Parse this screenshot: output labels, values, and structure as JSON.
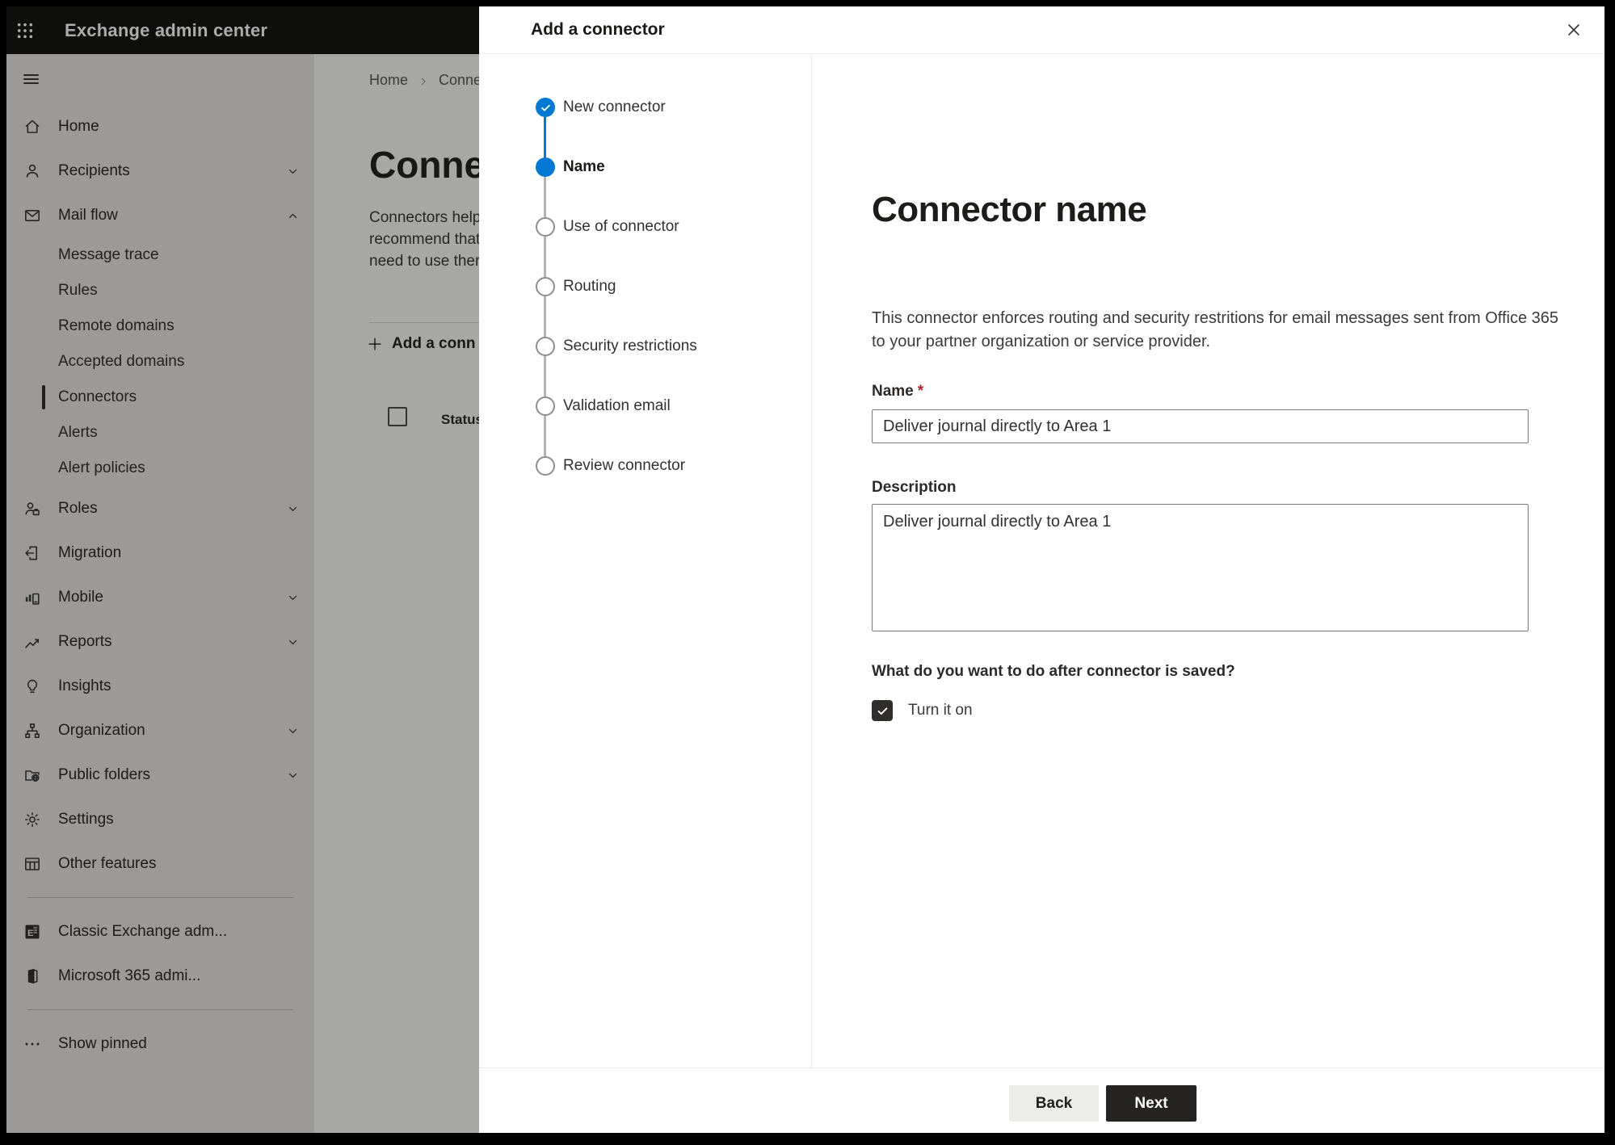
{
  "app": {
    "title": "Exchange admin center"
  },
  "sidebar": {
    "items": [
      {
        "label": "Home",
        "icon": "home"
      },
      {
        "label": "Recipients",
        "icon": "person",
        "chevron": "down"
      },
      {
        "label": "Mail flow",
        "icon": "mail",
        "chevron": "up"
      },
      {
        "label": "Message trace",
        "sub": true
      },
      {
        "label": "Rules",
        "sub": true
      },
      {
        "label": "Remote domains",
        "sub": true
      },
      {
        "label": "Accepted domains",
        "sub": true
      },
      {
        "label": "Connectors",
        "sub": true,
        "selected": true
      },
      {
        "label": "Alerts",
        "sub": true
      },
      {
        "label": "Alert policies",
        "sub": true
      },
      {
        "label": "Roles",
        "icon": "roles",
        "chevron": "down"
      },
      {
        "label": "Migration",
        "icon": "migration"
      },
      {
        "label": "Mobile",
        "icon": "mobile",
        "chevron": "down"
      },
      {
        "label": "Reports",
        "icon": "reports",
        "chevron": "down"
      },
      {
        "label": "Insights",
        "icon": "insights"
      },
      {
        "label": "Organization",
        "icon": "organization",
        "chevron": "down"
      },
      {
        "label": "Public folders",
        "icon": "public-folders",
        "chevron": "down"
      },
      {
        "label": "Settings",
        "icon": "settings"
      },
      {
        "label": "Other features",
        "icon": "other-features"
      },
      {
        "divider": true
      },
      {
        "label": "Classic Exchange adm...",
        "icon": "classic-exchange"
      },
      {
        "label": "Microsoft 365 admi...",
        "icon": "m365"
      },
      {
        "divider": true
      },
      {
        "label": "Show pinned",
        "icon": "ellipsis"
      }
    ]
  },
  "background_page": {
    "breadcrumb": {
      "home": "Home",
      "current": "Conne"
    },
    "title": "Connec",
    "intro_lines": [
      "Connectors help",
      "recommend that",
      "need to use ther"
    ],
    "add_button": "Add a conn",
    "status_header": "Status"
  },
  "dialog": {
    "title": "Add a connector",
    "steps": [
      {
        "label": "New connector",
        "state": "completed"
      },
      {
        "label": "Name",
        "state": "current"
      },
      {
        "label": "Use of connector",
        "state": "upcoming"
      },
      {
        "label": "Routing",
        "state": "upcoming"
      },
      {
        "label": "Security restrictions",
        "state": "upcoming"
      },
      {
        "label": "Validation email",
        "state": "upcoming"
      },
      {
        "label": "Review connector",
        "state": "upcoming"
      }
    ],
    "content": {
      "heading": "Connector name",
      "description_lines": [
        "This connector enforces routing and security restritions for email messages sent from Office 365",
        "to your partner organization or service provider."
      ],
      "name_label": "Name",
      "required_marker": "*",
      "name_value": "Deliver journal directly to Area 1",
      "description_label": "Description",
      "description_value": "Deliver journal directly to Area 1",
      "question": "What do you want to do after connector is saved?",
      "checkbox_label": "Turn it on",
      "checkbox_checked": true
    },
    "footer": {
      "back": "Back",
      "next": "Next"
    }
  },
  "colors": {
    "accent": "#0078d4",
    "header_bg": "#161514",
    "required": "#a4262c",
    "next_button_bg": "#252423",
    "overlay": "rgba(0,0,0,0.33)"
  }
}
